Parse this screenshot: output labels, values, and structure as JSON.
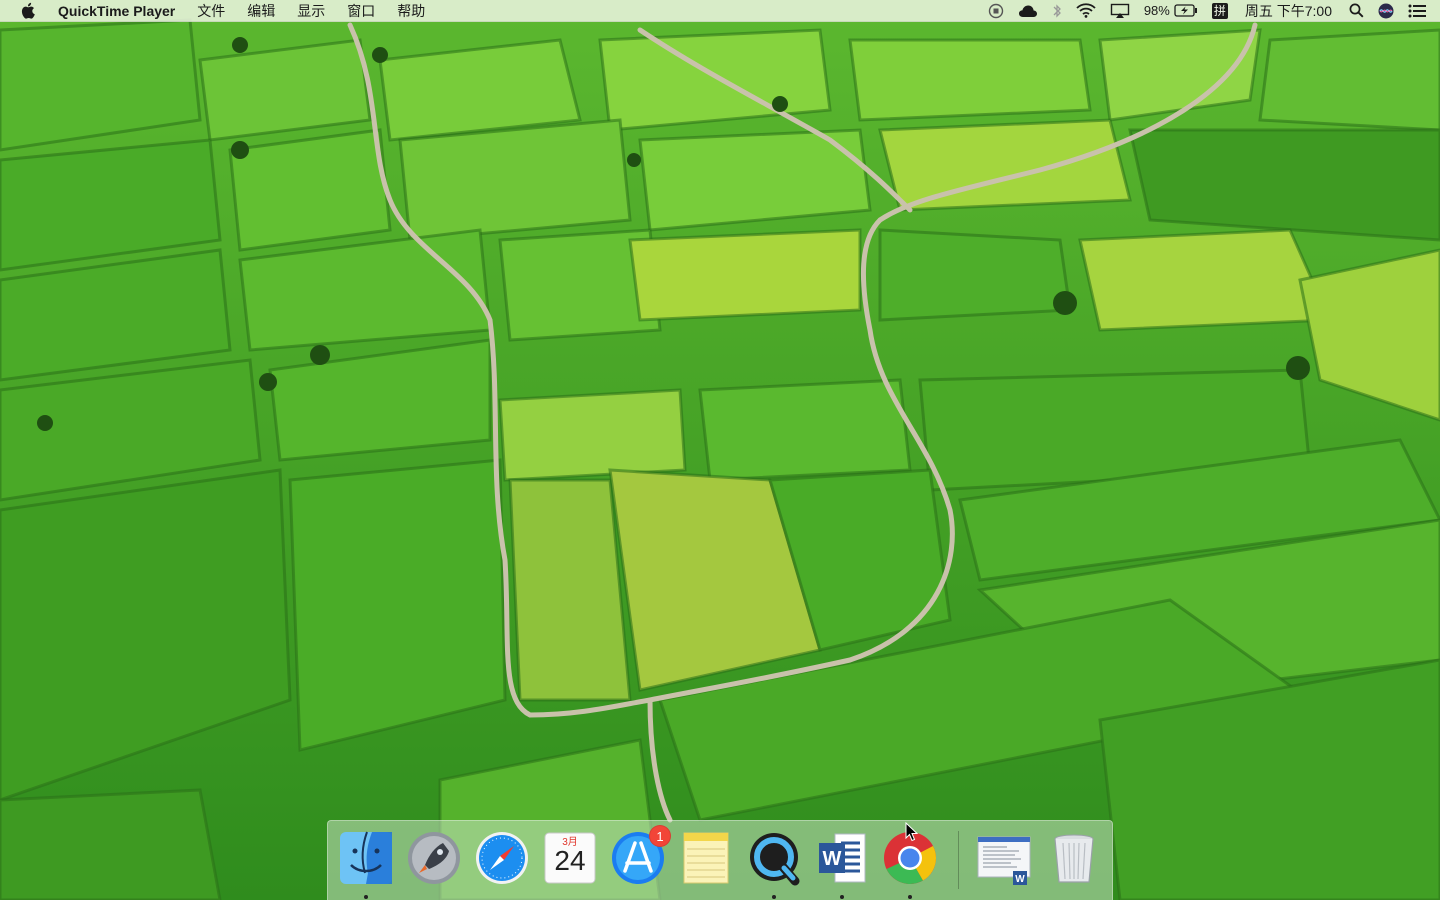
{
  "menubar": {
    "app_name": "QuickTime Player",
    "menus": [
      "文件",
      "编辑",
      "显示",
      "窗口",
      "帮助"
    ],
    "icons": [
      "apple-icon",
      "record-icon",
      "cloud-icon",
      "bluetooth-icon",
      "wifi-icon",
      "airplay-icon",
      "battery-icon",
      "input-method-icon",
      "spotlight-icon",
      "siri-icon",
      "notification-center-icon"
    ],
    "battery_percent": "98%",
    "input_method": "拼",
    "datetime": "周五 下午7:00"
  },
  "dock": {
    "apps": [
      {
        "name": "Finder",
        "icon": "finder-icon",
        "running": true
      },
      {
        "name": "Launchpad",
        "icon": "launchpad-icon",
        "running": false
      },
      {
        "name": "Safari",
        "icon": "safari-icon",
        "running": false
      },
      {
        "name": "Calendar",
        "icon": "calendar-icon",
        "running": false
      },
      {
        "name": "App Store",
        "icon": "app-store-icon",
        "running": false
      },
      {
        "name": "Notes",
        "icon": "notes-icon",
        "running": false
      },
      {
        "name": "QuickTime Player",
        "icon": "quicktime-icon",
        "running": true
      },
      {
        "name": "Microsoft Word",
        "icon": "word-icon",
        "running": true
      },
      {
        "name": "Google Chrome",
        "icon": "chrome-icon",
        "running": true
      },
      {
        "name": "Document",
        "icon": "document-icon",
        "running": false
      },
      {
        "name": "Trash",
        "icon": "trash-icon",
        "running": false
      }
    ],
    "app_store_badge": "1",
    "calendar_month": "3月",
    "calendar_day": "24"
  },
  "colors": {
    "menubar_bg": "#ecf4e2",
    "field_dark": "#3f9a22",
    "field_light": "#7fcf3a",
    "field_yellow": "#a9d63c",
    "road": "#b9b4a0",
    "badge": "#f24538"
  }
}
